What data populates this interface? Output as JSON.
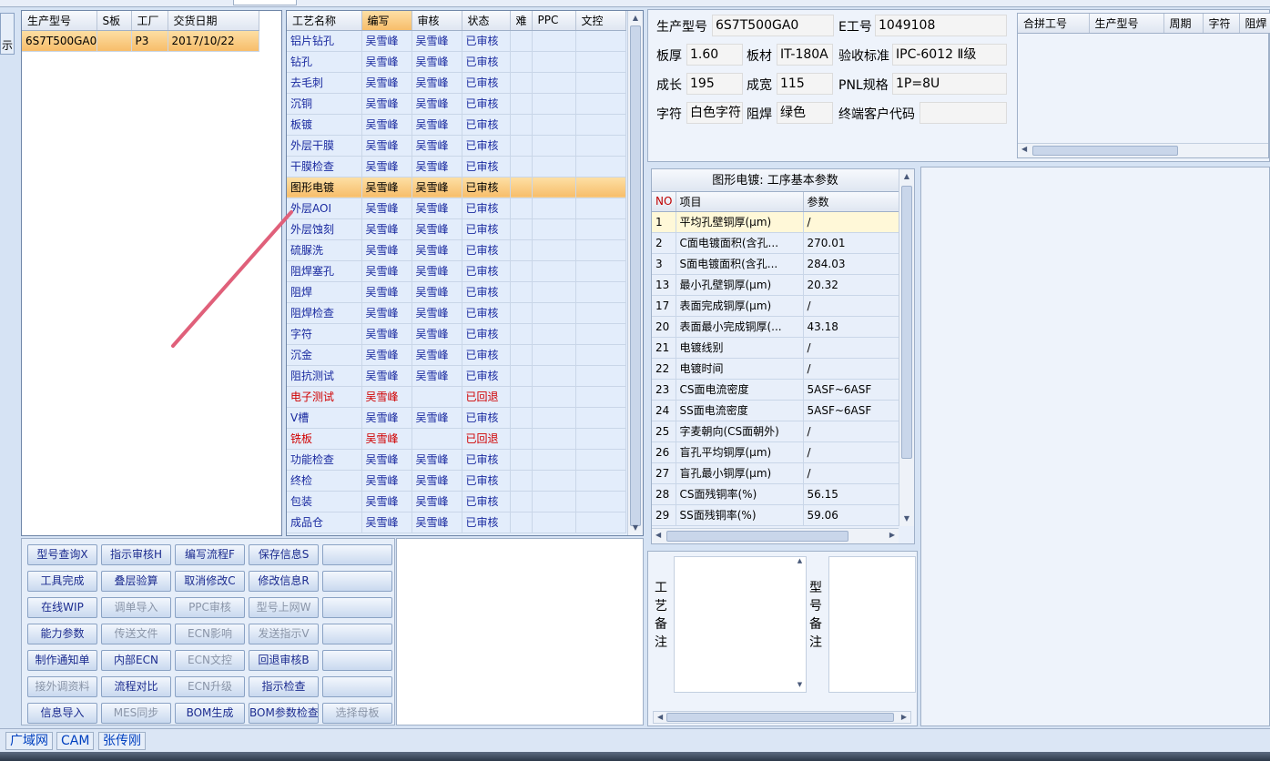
{
  "top_strip": {
    "partial_title": "—"
  },
  "left_tab": {
    "label": "示"
  },
  "orders": {
    "columns": [
      "生产型号",
      "S板",
      "工厂",
      "交货日期"
    ],
    "rows": [
      [
        "6S7T500GA0",
        "",
        "P3",
        "2017/10/22"
      ]
    ]
  },
  "process": {
    "columns": [
      "工艺名称",
      "编写",
      "审核",
      "状态",
      "难",
      "PPC",
      "文控"
    ],
    "rows": [
      {
        "name": "铝片钻孔",
        "writer": "吴雪峰",
        "reviewer": "吴雪峰",
        "status": "已审核",
        "state": "normal"
      },
      {
        "name": "钻孔",
        "writer": "吴雪峰",
        "reviewer": "吴雪峰",
        "status": "已审核",
        "state": "normal"
      },
      {
        "name": "去毛刺",
        "writer": "吴雪峰",
        "reviewer": "吴雪峰",
        "status": "已审核",
        "state": "normal"
      },
      {
        "name": "沉铜",
        "writer": "吴雪峰",
        "reviewer": "吴雪峰",
        "status": "已审核",
        "state": "normal"
      },
      {
        "name": "板镀",
        "writer": "吴雪峰",
        "reviewer": "吴雪峰",
        "status": "已审核",
        "state": "normal"
      },
      {
        "name": "外层干膜",
        "writer": "吴雪峰",
        "reviewer": "吴雪峰",
        "status": "已审核",
        "state": "normal"
      },
      {
        "name": "干膜检查",
        "writer": "吴雪峰",
        "reviewer": "吴雪峰",
        "status": "已审核",
        "state": "normal"
      },
      {
        "name": "图形电镀",
        "writer": "吴雪峰",
        "reviewer": "吴雪峰",
        "status": "已审核",
        "state": "selected"
      },
      {
        "name": "外层AOI",
        "writer": "吴雪峰",
        "reviewer": "吴雪峰",
        "status": "已审核",
        "state": "normal"
      },
      {
        "name": "外层蚀刻",
        "writer": "吴雪峰",
        "reviewer": "吴雪峰",
        "status": "已审核",
        "state": "normal"
      },
      {
        "name": "硫脲洗",
        "writer": "吴雪峰",
        "reviewer": "吴雪峰",
        "status": "已审核",
        "state": "normal"
      },
      {
        "name": "阻焊塞孔",
        "writer": "吴雪峰",
        "reviewer": "吴雪峰",
        "status": "已审核",
        "state": "normal"
      },
      {
        "name": "阻焊",
        "writer": "吴雪峰",
        "reviewer": "吴雪峰",
        "status": "已审核",
        "state": "normal"
      },
      {
        "name": "阻焊检查",
        "writer": "吴雪峰",
        "reviewer": "吴雪峰",
        "status": "已审核",
        "state": "normal"
      },
      {
        "name": "字符",
        "writer": "吴雪峰",
        "reviewer": "吴雪峰",
        "status": "已审核",
        "state": "normal"
      },
      {
        "name": "沉金",
        "writer": "吴雪峰",
        "reviewer": "吴雪峰",
        "status": "已审核",
        "state": "normal"
      },
      {
        "name": "阻抗测试",
        "writer": "吴雪峰",
        "reviewer": "吴雪峰",
        "status": "已审核",
        "state": "normal"
      },
      {
        "name": "电子测试",
        "writer": "吴雪峰",
        "reviewer": "",
        "status": "已回退",
        "state": "red"
      },
      {
        "name": "V槽",
        "writer": "吴雪峰",
        "reviewer": "吴雪峰",
        "status": "已审核",
        "state": "normal"
      },
      {
        "name": "铣板",
        "writer": "吴雪峰",
        "reviewer": "",
        "status": "已回退",
        "state": "red"
      },
      {
        "name": "功能检查",
        "writer": "吴雪峰",
        "reviewer": "吴雪峰",
        "status": "已审核",
        "state": "normal"
      },
      {
        "name": "终检",
        "writer": "吴雪峰",
        "reviewer": "吴雪峰",
        "status": "已审核",
        "state": "normal"
      },
      {
        "name": "包装",
        "writer": "吴雪峰",
        "reviewer": "吴雪峰",
        "status": "已审核",
        "state": "normal"
      },
      {
        "name": "成品仓",
        "writer": "吴雪峰",
        "reviewer": "吴雪峰",
        "status": "已审核",
        "state": "normal"
      }
    ]
  },
  "info": {
    "model_label": "生产型号",
    "model_value": "6S7T500GA0",
    "e_label": "E工号",
    "e_value": "1049108",
    "thickness_label": "板厚",
    "thickness_value": "1.60",
    "material_label": "板材",
    "material_value": "IT-180A",
    "standard_label": "验收标准",
    "standard_value": "IPC-6012 Ⅱ级",
    "length_label": "成长",
    "length_value": "195",
    "width_label": "成宽",
    "width_value": "115",
    "pnl_label": "PNL规格",
    "pnl_value": "1P=8U",
    "char_label": "字符",
    "char_value": "白色字符",
    "mask_label": "阻焊",
    "mask_value": "绿色",
    "client_label": "终端客户代码",
    "client_value": ""
  },
  "merge": {
    "columns": [
      "合拼工号",
      "生产型号",
      "周期",
      "字符",
      "阻焊"
    ]
  },
  "params": {
    "title": "图形电镀: 工序基本参数",
    "columns": [
      "NO",
      "项目",
      "参数"
    ],
    "rows": [
      [
        "1",
        "平均孔壁铜厚(μm)",
        "/"
      ],
      [
        "2",
        "C面电镀面积(含孔...",
        "270.01"
      ],
      [
        "3",
        "S面电镀面积(含孔...",
        "284.03"
      ],
      [
        "13",
        "最小孔壁铜厚(μm)",
        "20.32"
      ],
      [
        "17",
        "表面完成铜厚(μm)",
        "/"
      ],
      [
        "20",
        "表面最小完成铜厚(...",
        "43.18"
      ],
      [
        "21",
        "电镀线别",
        "/"
      ],
      [
        "22",
        "电镀时间",
        "/"
      ],
      [
        "23",
        "CS面电流密度",
        "5ASF~6ASF"
      ],
      [
        "24",
        "SS面电流密度",
        "5ASF~6ASF"
      ],
      [
        "25",
        "字麦朝向(CS面朝外)",
        "/"
      ],
      [
        "26",
        "盲孔平均铜厚(μm)",
        "/"
      ],
      [
        "27",
        "盲孔最小铜厚(μm)",
        "/"
      ],
      [
        "28",
        "CS面残铜率(%)",
        "56.15"
      ],
      [
        "29",
        "SS面残铜率(%)",
        "59.06"
      ]
    ]
  },
  "notes": {
    "process_label": "工艺备注",
    "model_label": "型号备注"
  },
  "buttons": [
    [
      "型号查询X",
      "指示审核H",
      "编写流程F",
      "保存信息S",
      ""
    ],
    [
      "工具完成",
      "叠层验算",
      "取消修改C",
      "修改信息R",
      ""
    ],
    [
      "在线WIP",
      "调单导入",
      "PPC审核",
      "型号上网W",
      ""
    ],
    [
      "能力参数",
      "传送文件",
      "ECN影响",
      "发送指示V",
      ""
    ],
    [
      "制作通知单",
      "内部ECN",
      "ECN文控",
      "回退审核B",
      ""
    ],
    [
      "接外调资料",
      "流程对比",
      "ECN升级",
      "指示检查",
      ""
    ],
    [
      "信息导入",
      "MES同步",
      "BOM生成",
      "BOM参数检查",
      "选择母板"
    ]
  ],
  "buttons_disabled": [
    [
      false,
      false,
      false,
      false,
      false
    ],
    [
      false,
      false,
      false,
      false,
      false
    ],
    [
      false,
      true,
      true,
      true,
      false
    ],
    [
      false,
      true,
      true,
      true,
      false
    ],
    [
      false,
      false,
      true,
      false,
      false
    ],
    [
      true,
      false,
      true,
      false,
      false
    ],
    [
      false,
      true,
      false,
      false,
      true
    ]
  ],
  "status": {
    "net": "广域网",
    "module": "CAM",
    "user": "张传刚"
  },
  "colors": {
    "selected": "#f7bd6a",
    "returned": "#d00000",
    "accent": "#1a2aa0"
  }
}
